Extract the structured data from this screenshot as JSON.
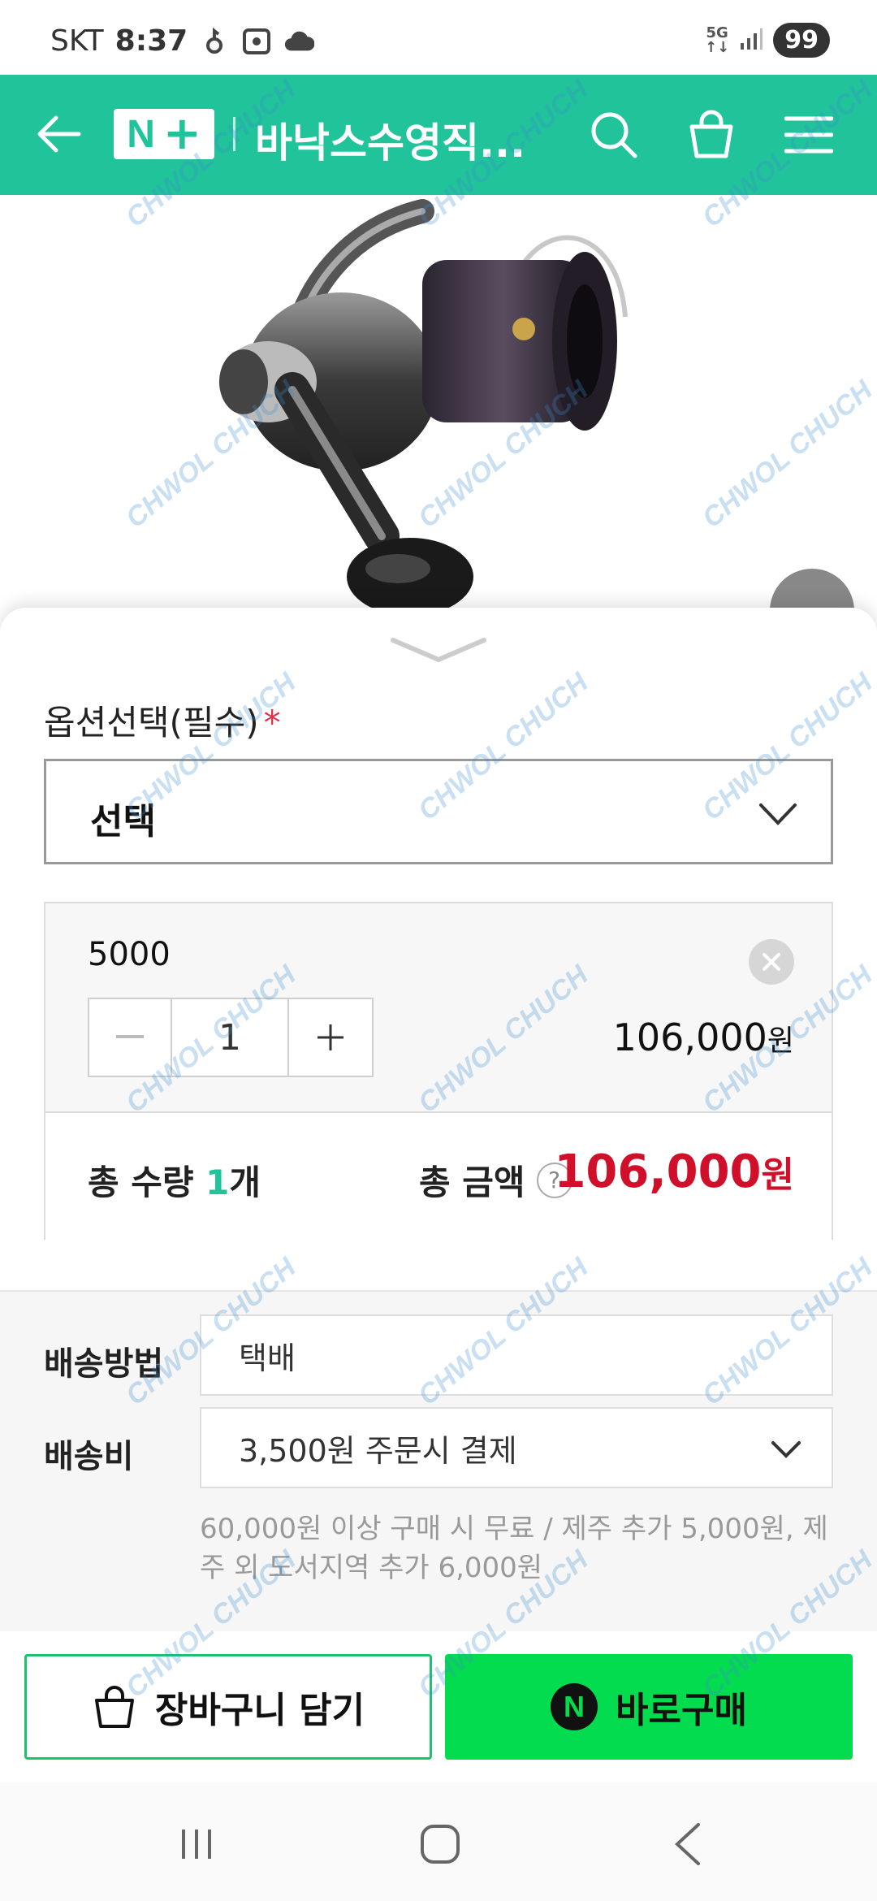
{
  "status_bar": {
    "carrier": "SKT",
    "time": "8:37",
    "network": "5G",
    "battery": "99"
  },
  "header": {
    "logo_text": "N",
    "store_name": "바낙스수영직..."
  },
  "option": {
    "label": "옵션선택(필수)",
    "required_mark": "*",
    "select_value": "선택"
  },
  "selected_item": {
    "name": "5000",
    "quantity": "1",
    "price": "106,000",
    "price_unit": "원"
  },
  "totals": {
    "qty_label": "총 수량",
    "qty_value": "1",
    "qty_unit": "개",
    "amount_label": "총 금액",
    "help_symbol": "?",
    "amount_value": "106,000",
    "amount_unit": "원"
  },
  "shipping": {
    "method_label": "배송방법",
    "method_value": "택배",
    "fee_label": "배송비",
    "fee_value": "3,500원 주문시 결제",
    "note": "60,000원 이상 구매 시 무료 / 제주 추가 5,000원, 제주 외 도서지역 추가 6,000원"
  },
  "actions": {
    "cart_label": "장바구니 담기",
    "buy_label": "바로구매",
    "buy_logo": "N"
  },
  "watermark": "CHWOL CHUCH",
  "colors": {
    "header_green": "#20c39a",
    "buy_green": "#03dc4f",
    "price_red": "#d0102b",
    "required_red": "#e0334c"
  }
}
